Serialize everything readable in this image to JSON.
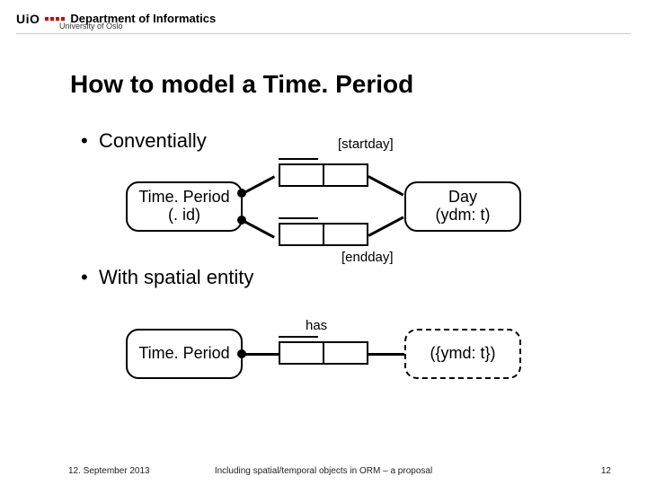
{
  "header": {
    "logo_text": "UiO",
    "department": "Department of Informatics",
    "university": "University of Oslo"
  },
  "title": "How to model a Time. Period",
  "bullets": {
    "conventionally": "Conventially",
    "with_spatial": "With spatial entity"
  },
  "diagram1": {
    "left_entity": {
      "line1": "Time. Period",
      "line2": "(. id)"
    },
    "right_entity": {
      "line1": "Day",
      "line2": "(ydm: t)"
    },
    "top_reading": "[startday]",
    "bottom_reading": "[endday]"
  },
  "diagram2": {
    "left_entity": {
      "line1": "Time. Period"
    },
    "right_entity": {
      "line1": "({ymd: t})"
    },
    "reading": "has"
  },
  "footer": {
    "date": "12. September 2013",
    "center": "Including spatial/temporal objects in ORM – a proposal",
    "page": "12"
  },
  "chart_data": {
    "type": "diagram",
    "notation": "ORM",
    "title": "How to model a Time.Period",
    "models": [
      {
        "label": "Conventially",
        "entities": [
          {
            "name": "Time.Period",
            "ref_mode": ".id",
            "kind": "entity"
          },
          {
            "name": "Day",
            "ref_mode": "ydm:t",
            "kind": "entity"
          }
        ],
        "fact_types": [
          {
            "roles": [
              "Time.Period",
              "Day"
            ],
            "reading": "[startday]",
            "mandatory_on": "Time.Period",
            "uniqueness": [
              "role1"
            ]
          },
          {
            "roles": [
              "Time.Period",
              "Day"
            ],
            "reading": "[endday]",
            "mandatory_on": "Time.Period",
            "uniqueness": [
              "role1"
            ]
          }
        ]
      },
      {
        "label": "With spatial entity",
        "entities": [
          {
            "name": "Time.Period",
            "kind": "entity"
          },
          {
            "name": "{ymd:t}",
            "kind": "value"
          }
        ],
        "fact_types": [
          {
            "roles": [
              "Time.Period",
              "{ymd:t}"
            ],
            "reading": "has",
            "mandatory_on": "Time.Period",
            "uniqueness": [
              "role1"
            ]
          }
        ]
      }
    ]
  }
}
